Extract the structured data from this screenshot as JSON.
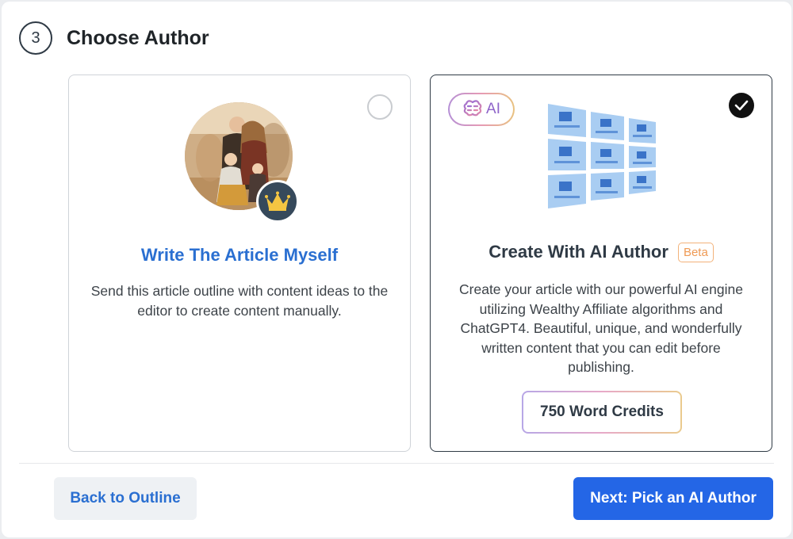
{
  "step": {
    "number": "3",
    "title": "Choose Author"
  },
  "options": {
    "manual": {
      "title": "Write The Article Myself",
      "description": "Send this article outline with content ideas to the editor to create content manually."
    },
    "ai": {
      "badge": "AI",
      "title": "Create With AI Author",
      "beta": "Beta",
      "description": "Create your article with our powerful AI engine utilizing Wealthy Affiliate algorithms and ChatGPT4. Beautiful, unique, and wonderfully written content that you can edit before publishing.",
      "credits": "750 Word Credits",
      "selected": true
    }
  },
  "buttons": {
    "back": "Back to Outline",
    "next": "Next: Pick an AI Author"
  },
  "colors": {
    "primary": "#2466e6",
    "link": "#2a6fd1",
    "beta": "#ef9a55",
    "crown": "#f4c542"
  },
  "icons": [
    "crown-icon",
    "brain-icon",
    "checkmark-icon",
    "radio-empty-icon",
    "content-grid-icon"
  ]
}
